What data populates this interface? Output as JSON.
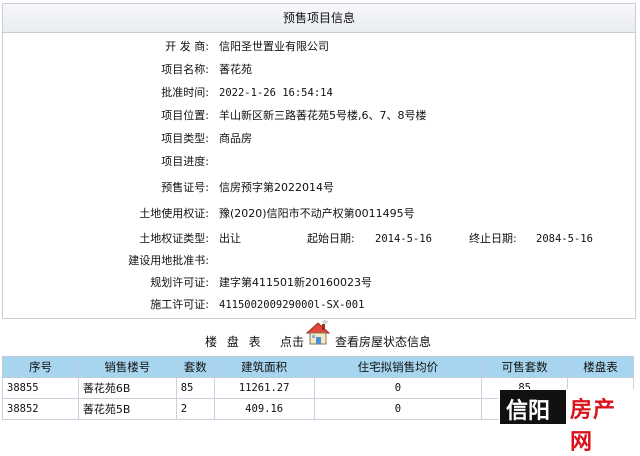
{
  "panel": {
    "title": "预售项目信息",
    "fields": [
      {
        "label": "开 发 商:",
        "value": "信阳圣世置业有限公司"
      },
      {
        "label": "项目名称:",
        "value": "萫花苑"
      },
      {
        "label": "批准时间:",
        "value": "2022-1-26 16:54:14"
      },
      {
        "label": "项目位置:",
        "value": "羊山新区新三路萫花苑5号楼,6、7、8号楼"
      },
      {
        "label": "项目类型:",
        "value": "商品房"
      },
      {
        "label": "项目进度:",
        "value": ""
      },
      {
        "label": "预售证号:",
        "value": "信房预字第2022014号"
      },
      {
        "label": "土地使用权证:",
        "value": "豫(2020)信阳市不动产权第0011495号"
      },
      {
        "label": "土地权证类型:",
        "value": "出让"
      },
      {
        "label": "建设用地批准书:",
        "value": ""
      },
      {
        "label": "规划许可证:",
        "value": "建字第411501新20160023号"
      },
      {
        "label": "施工许可证:",
        "value": "411500200929000l-SX-001"
      }
    ],
    "start_date_label": "起始日期:",
    "start_date": "2014-5-16",
    "end_date_label": "终止日期:",
    "end_date": "2084-5-16"
  },
  "caption": {
    "table_label": "楼 盘 表",
    "click_label": "点击",
    "link_label": "查看房屋状态信息",
    "house_icon": "house-icon"
  },
  "table": {
    "headers": [
      "序号",
      "销售楼号",
      "套数",
      "建筑面积",
      "住宅拟销售均价",
      "可售套数",
      "楼盘表"
    ],
    "rows": [
      [
        "38855",
        "萫花苑6B",
        "85",
        "11261.27",
        "0",
        "85",
        ""
      ],
      [
        "38852",
        "萫花苑5B",
        "2",
        "409.16",
        "0",
        "",
        ""
      ]
    ]
  },
  "watermark": {
    "text_a": "信阳",
    "text_b": "房产网"
  },
  "colors": {
    "header_bg": "#a7d5ef",
    "watermark_red": "#d9121b"
  }
}
